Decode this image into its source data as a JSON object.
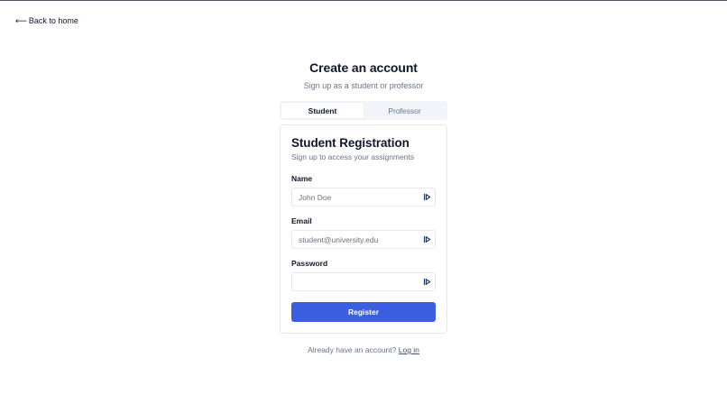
{
  "nav": {
    "back_label": "Back to home",
    "back_arrow": "⟵"
  },
  "header": {
    "title": "Create an account",
    "subtitle": "Sign up as a student or professor"
  },
  "tabs": [
    {
      "label": "Student",
      "active": true
    },
    {
      "label": "Professor",
      "active": false
    }
  ],
  "card": {
    "title": "Student Registration",
    "description": "Sign up to access your assignments",
    "fields": {
      "name": {
        "label": "Name",
        "placeholder": "John Doe",
        "value": ""
      },
      "email": {
        "label": "Email",
        "placeholder": "student@university.edu",
        "value": ""
      },
      "password": {
        "label": "Password",
        "placeholder": "",
        "value": ""
      }
    },
    "submit_label": "Register"
  },
  "footer": {
    "prompt": "Already have an account?",
    "login_label": "Log in"
  },
  "colors": {
    "primary": "#3b5fe0",
    "muted": "#64748b",
    "border": "#e5e7eb",
    "tab_bg": "#f1f5f9",
    "icon": "#1e3a5f"
  },
  "icons": {
    "field_action": "autofill-key-icon"
  }
}
